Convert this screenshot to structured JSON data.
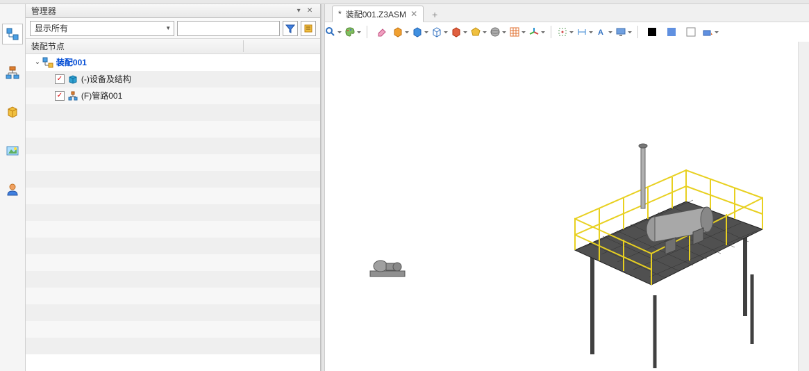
{
  "panel": {
    "title": "管理器",
    "filter": {
      "dropdown_label": "显示所有",
      "search_placeholder": ""
    },
    "tree_header": {
      "col1": "装配节点",
      "col2": ""
    },
    "tree": {
      "root": {
        "label": "装配001",
        "expanded": true
      },
      "children": [
        {
          "checked": true,
          "label": "(-)设备及结构",
          "icon": "cube"
        },
        {
          "checked": true,
          "label": "(F)管路001",
          "icon": "pipe"
        }
      ]
    }
  },
  "tabs": {
    "active": {
      "modified_indicator": "*",
      "filename": "装配001.Z3ASM"
    }
  },
  "sidebar_icons": [
    "assembly-tree-icon",
    "hierarchy-icon",
    "box-icon",
    "image-icon",
    "person-icon"
  ],
  "viewport_toolbar_icons": [
    "magnifier-icon",
    "palette-icon",
    "eraser-icon",
    "cube-orange-icon",
    "cube-blue-icon",
    "cube-wire-icon",
    "cube-red-icon",
    "polyhedron-icon",
    "sphere-icon",
    "grid-icon",
    "axis-icon",
    "marker-icon",
    "dimension-icon",
    "text-icon",
    "monitor-icon",
    "rect-black-color",
    "rect-blue-color",
    "rect-outline-color",
    "rect-arrow-icon"
  ]
}
